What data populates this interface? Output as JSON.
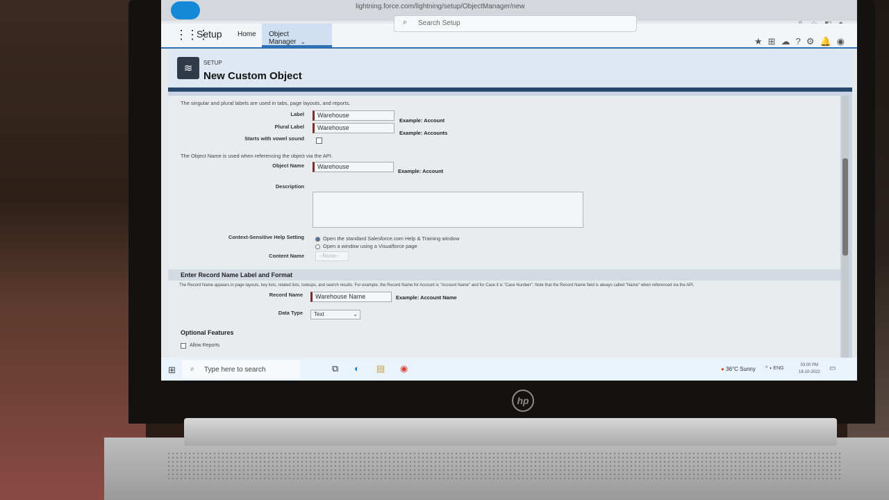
{
  "browser": {
    "url": "lightning.force.com/lightning/setup/ObjectManager/new",
    "search_placeholder": "Search Setup"
  },
  "nav": {
    "app_name": "Setup",
    "tabs": [
      {
        "label": "Home"
      },
      {
        "label": "Object Manager"
      }
    ]
  },
  "header": {
    "eyebrow": "SETUP",
    "title": "New Custom Object"
  },
  "form": {
    "labels_note": "The singular and plural labels are used in tabs, page layouts, and reports.",
    "label": {
      "label": "Label",
      "value": "Warehouse",
      "example": "Example:  Account"
    },
    "plural_label": {
      "label": "Plural Label",
      "value": "Warehouse",
      "example": "Example:  Accounts"
    },
    "vowel": {
      "label": "Starts with vowel sound"
    },
    "api_note": "The Object Name is used when referencing the object via the API.",
    "object_name": {
      "label": "Object Name",
      "value": "Warehouse",
      "example": "Example:  Account"
    },
    "description": {
      "label": "Description"
    },
    "help": {
      "label": "Context-Sensitive Help Setting",
      "option1": "Open the standard Salesforce.com Help & Training window",
      "option2": "Open a window using a Visualforce page"
    },
    "content_name": {
      "label": "Content Name",
      "value": "--None--"
    },
    "record_section": {
      "title": "Enter Record Name Label and Format",
      "note": "The Record Name appears in page layouts, key lists, related lists, lookups, and search results. For example, the Record Name for Account is \"Account Name\" and for Case it is \"Case Number\". Note that the Record Name field is always called \"Name\" when referenced via the API.",
      "record_name": {
        "label": "Record Name",
        "value": "Warehouse Name",
        "example": "Example:  Account Name"
      },
      "data_type": {
        "label": "Data Type",
        "value": "Text"
      }
    },
    "optional": {
      "title": "Optional Features",
      "allow_reports": "Allow Reports"
    }
  },
  "taskbar": {
    "search_placeholder": "Type here to search",
    "weather": "36°C  Sunny",
    "lang": "ENG",
    "time": "03:00 PM",
    "date": "18-10-2022"
  },
  "device": {
    "brand": "hp"
  }
}
